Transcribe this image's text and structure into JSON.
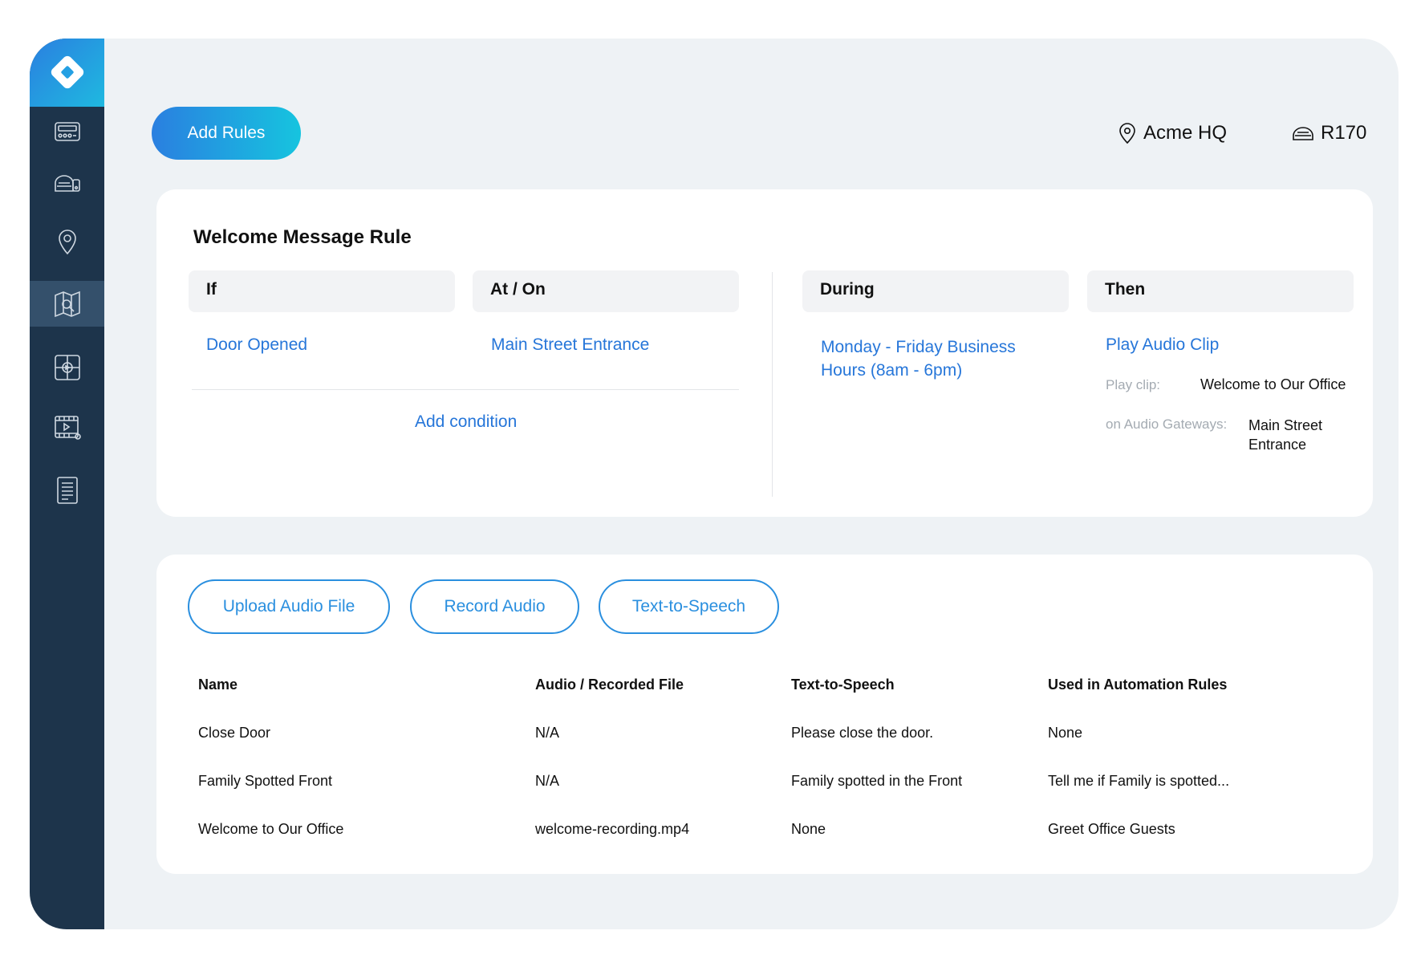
{
  "toolbar": {
    "add_rules_label": "Add Rules"
  },
  "header": {
    "location": "Acme HQ",
    "device": "R170"
  },
  "rule": {
    "title": "Welcome Message Rule",
    "columns": {
      "if": "If",
      "at_on": "At / On",
      "during": "During",
      "then": "Then"
    },
    "if_value": "Door Opened",
    "at_value": "Main Street Entrance",
    "add_condition": "Add condition",
    "during_line1": "Monday - Friday Business",
    "during_line2": "Hours (8am - 6pm)",
    "then_value": "Play Audio Clip",
    "play_clip_label": "Play clip:",
    "play_clip_value": "Welcome to Our Office",
    "gateways_label": "on Audio Gateways:",
    "gateways_line1": "Main Street",
    "gateways_line2": "Entrance"
  },
  "audio": {
    "buttons": {
      "upload": "Upload Audio File",
      "record": "Record Audio",
      "tts": "Text-to-Speech"
    },
    "headers": [
      "Name",
      "Audio / Recorded File",
      "Text-to-Speech",
      "Used in Automation Rules"
    ],
    "rows": [
      [
        "Close Door",
        "N/A",
        "Please close the door.",
        "None"
      ],
      [
        "Family Spotted Front",
        "N/A",
        "Family spotted in the Front",
        "Tell me if Family is spotted..."
      ],
      [
        "Welcome to Our Office",
        "welcome-recording.mp4",
        "None",
        "Greet Office Guests"
      ]
    ]
  },
  "sidebar": {
    "icons": [
      "dashboard-icon",
      "devices-icon",
      "location-icon",
      "map-icon",
      "camera-icon",
      "media-icon",
      "document-icon"
    ],
    "active": "map-icon"
  },
  "colors": {
    "sidebar": "#1d344b",
    "accent": "#2676d9",
    "background": "#eef2f5"
  }
}
